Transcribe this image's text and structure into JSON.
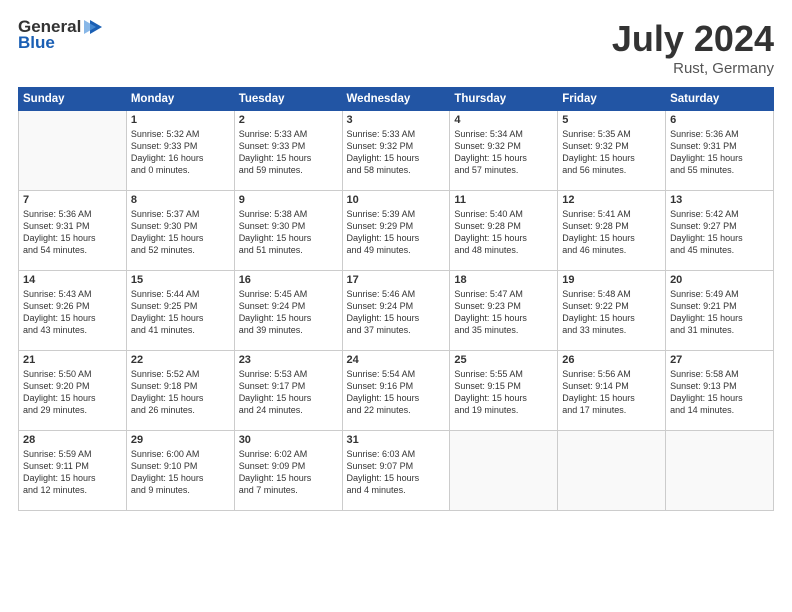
{
  "header": {
    "logo": {
      "general": "General",
      "blue": "Blue"
    },
    "title": "July 2024",
    "location": "Rust, Germany"
  },
  "weekdays": [
    "Sunday",
    "Monday",
    "Tuesday",
    "Wednesday",
    "Thursday",
    "Friday",
    "Saturday"
  ],
  "weeks": [
    [
      {
        "day": "",
        "info": ""
      },
      {
        "day": "1",
        "info": "Sunrise: 5:32 AM\nSunset: 9:33 PM\nDaylight: 16 hours\nand 0 minutes."
      },
      {
        "day": "2",
        "info": "Sunrise: 5:33 AM\nSunset: 9:33 PM\nDaylight: 15 hours\nand 59 minutes."
      },
      {
        "day": "3",
        "info": "Sunrise: 5:33 AM\nSunset: 9:32 PM\nDaylight: 15 hours\nand 58 minutes."
      },
      {
        "day": "4",
        "info": "Sunrise: 5:34 AM\nSunset: 9:32 PM\nDaylight: 15 hours\nand 57 minutes."
      },
      {
        "day": "5",
        "info": "Sunrise: 5:35 AM\nSunset: 9:32 PM\nDaylight: 15 hours\nand 56 minutes."
      },
      {
        "day": "6",
        "info": "Sunrise: 5:36 AM\nSunset: 9:31 PM\nDaylight: 15 hours\nand 55 minutes."
      }
    ],
    [
      {
        "day": "7",
        "info": "Sunrise: 5:36 AM\nSunset: 9:31 PM\nDaylight: 15 hours\nand 54 minutes."
      },
      {
        "day": "8",
        "info": "Sunrise: 5:37 AM\nSunset: 9:30 PM\nDaylight: 15 hours\nand 52 minutes."
      },
      {
        "day": "9",
        "info": "Sunrise: 5:38 AM\nSunset: 9:30 PM\nDaylight: 15 hours\nand 51 minutes."
      },
      {
        "day": "10",
        "info": "Sunrise: 5:39 AM\nSunset: 9:29 PM\nDaylight: 15 hours\nand 49 minutes."
      },
      {
        "day": "11",
        "info": "Sunrise: 5:40 AM\nSunset: 9:28 PM\nDaylight: 15 hours\nand 48 minutes."
      },
      {
        "day": "12",
        "info": "Sunrise: 5:41 AM\nSunset: 9:28 PM\nDaylight: 15 hours\nand 46 minutes."
      },
      {
        "day": "13",
        "info": "Sunrise: 5:42 AM\nSunset: 9:27 PM\nDaylight: 15 hours\nand 45 minutes."
      }
    ],
    [
      {
        "day": "14",
        "info": "Sunrise: 5:43 AM\nSunset: 9:26 PM\nDaylight: 15 hours\nand 43 minutes."
      },
      {
        "day": "15",
        "info": "Sunrise: 5:44 AM\nSunset: 9:25 PM\nDaylight: 15 hours\nand 41 minutes."
      },
      {
        "day": "16",
        "info": "Sunrise: 5:45 AM\nSunset: 9:24 PM\nDaylight: 15 hours\nand 39 minutes."
      },
      {
        "day": "17",
        "info": "Sunrise: 5:46 AM\nSunset: 9:24 PM\nDaylight: 15 hours\nand 37 minutes."
      },
      {
        "day": "18",
        "info": "Sunrise: 5:47 AM\nSunset: 9:23 PM\nDaylight: 15 hours\nand 35 minutes."
      },
      {
        "day": "19",
        "info": "Sunrise: 5:48 AM\nSunset: 9:22 PM\nDaylight: 15 hours\nand 33 minutes."
      },
      {
        "day": "20",
        "info": "Sunrise: 5:49 AM\nSunset: 9:21 PM\nDaylight: 15 hours\nand 31 minutes."
      }
    ],
    [
      {
        "day": "21",
        "info": "Sunrise: 5:50 AM\nSunset: 9:20 PM\nDaylight: 15 hours\nand 29 minutes."
      },
      {
        "day": "22",
        "info": "Sunrise: 5:52 AM\nSunset: 9:18 PM\nDaylight: 15 hours\nand 26 minutes."
      },
      {
        "day": "23",
        "info": "Sunrise: 5:53 AM\nSunset: 9:17 PM\nDaylight: 15 hours\nand 24 minutes."
      },
      {
        "day": "24",
        "info": "Sunrise: 5:54 AM\nSunset: 9:16 PM\nDaylight: 15 hours\nand 22 minutes."
      },
      {
        "day": "25",
        "info": "Sunrise: 5:55 AM\nSunset: 9:15 PM\nDaylight: 15 hours\nand 19 minutes."
      },
      {
        "day": "26",
        "info": "Sunrise: 5:56 AM\nSunset: 9:14 PM\nDaylight: 15 hours\nand 17 minutes."
      },
      {
        "day": "27",
        "info": "Sunrise: 5:58 AM\nSunset: 9:13 PM\nDaylight: 15 hours\nand 14 minutes."
      }
    ],
    [
      {
        "day": "28",
        "info": "Sunrise: 5:59 AM\nSunset: 9:11 PM\nDaylight: 15 hours\nand 12 minutes."
      },
      {
        "day": "29",
        "info": "Sunrise: 6:00 AM\nSunset: 9:10 PM\nDaylight: 15 hours\nand 9 minutes."
      },
      {
        "day": "30",
        "info": "Sunrise: 6:02 AM\nSunset: 9:09 PM\nDaylight: 15 hours\nand 7 minutes."
      },
      {
        "day": "31",
        "info": "Sunrise: 6:03 AM\nSunset: 9:07 PM\nDaylight: 15 hours\nand 4 minutes."
      },
      {
        "day": "",
        "info": ""
      },
      {
        "day": "",
        "info": ""
      },
      {
        "day": "",
        "info": ""
      }
    ]
  ]
}
